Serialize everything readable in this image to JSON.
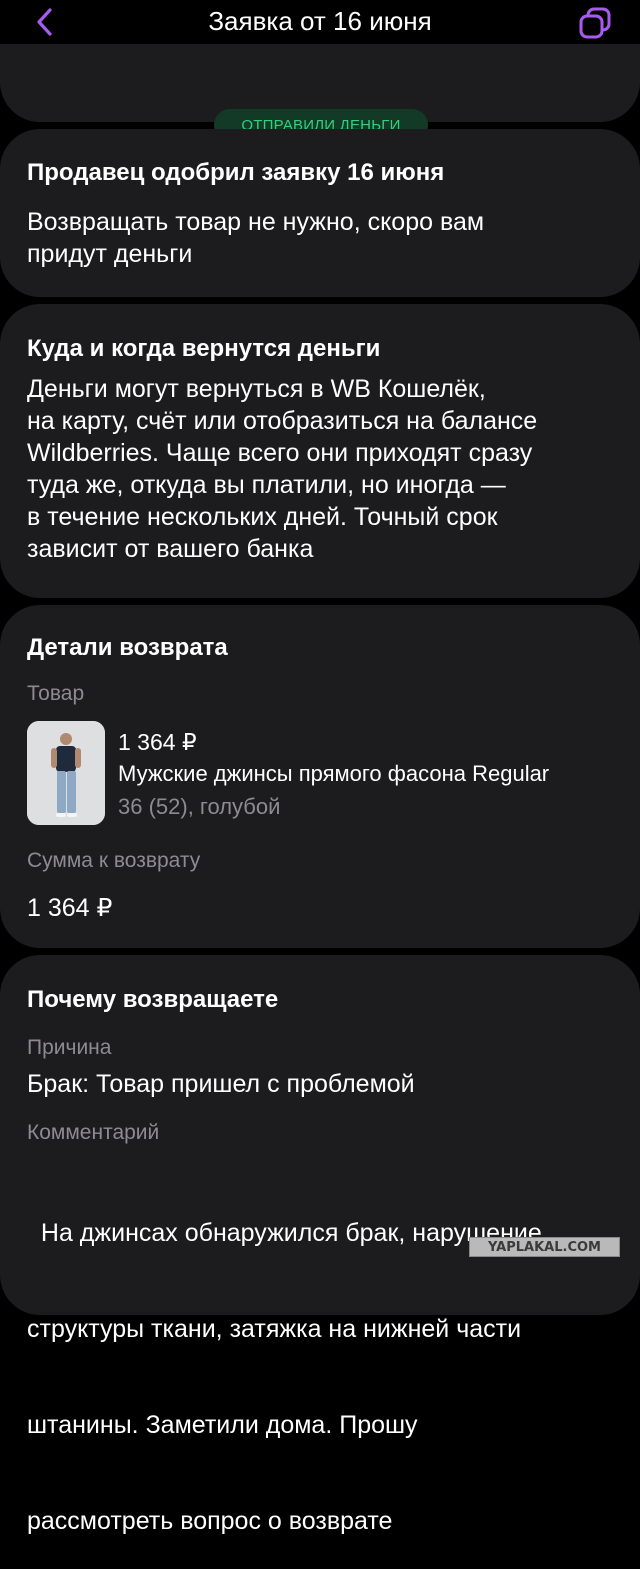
{
  "header": {
    "title": "Заявка от 16 июня",
    "back_icon": "chevron-left-icon",
    "copy_icon": "copy-icon",
    "accent_color": "#a85bf0"
  },
  "status_badge": {
    "text": "ОТПРАВИЛИ ДЕНЬГИ",
    "color": "#30d27b"
  },
  "approval": {
    "title": "Продавец одобрил заявку 16 июня",
    "lines": [
      "Возвращать товар не нужно, скоро вам",
      "придут деньги"
    ]
  },
  "refund_info": {
    "title": "Куда и когда вернутся деньги",
    "lines": [
      "Деньги могут вернуться в WB Кошелёк,",
      "на карту, счёт или отобразиться на балансе",
      "Wildberries. Чаще всего они приходят сразу",
      "туда же, откуда вы платили, но иногда —",
      "в течение нескольких дней. Точный срок",
      "зависит от вашего банка"
    ]
  },
  "details": {
    "title": "Детали возврата",
    "product_label": "Товар",
    "product": {
      "price": "1 364 ₽",
      "name": "Мужские джинсы прямого фасона Regular",
      "variant": "36 (52), голубой"
    },
    "amount_label": "Сумма к возврату",
    "amount": "1 364 ₽"
  },
  "reason": {
    "title": "Почему возвращаете",
    "reason_label": "Причина",
    "reason_value": "Брак: Товар пришел с проблемой",
    "comment_label": "Комментарий",
    "comment_lines": [
      "  На джинсах обнаружился брак, нарушение",
      "структуры ткани, затяжка на нижней части",
      "штанины. Заметили дома. Прошу",
      "рассмотреть вопрос о возврате"
    ]
  },
  "watermark": "YAPLAKAL.COM"
}
